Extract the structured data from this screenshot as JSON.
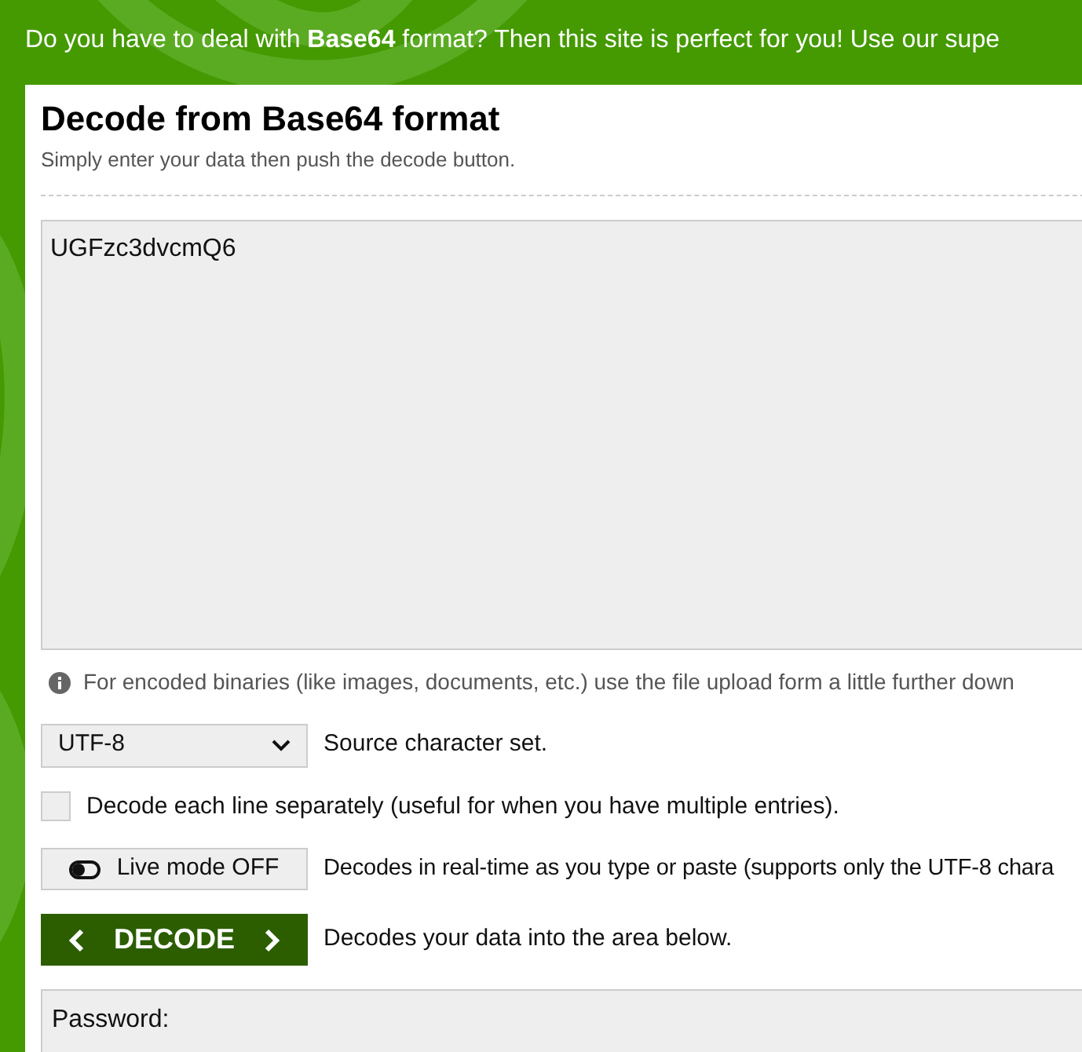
{
  "banner": {
    "text": "Do you have to deal with **Base64** format? Then this site is perfect for you! Use our supe"
  },
  "panel": {
    "title": "Decode from Base64 format",
    "subtitle": "Simply enter your data then push the decode button."
  },
  "input": {
    "value": "UGFzc3dvcmQ6"
  },
  "info": "For encoded binaries (like images, documents, etc.) use the file upload form a little further down",
  "charset": {
    "value": "UTF-8",
    "description": "Source character set."
  },
  "separate_lines": {
    "checked": false,
    "label": "Decode each line separately (useful for when you have multiple entries)."
  },
  "live_mode": {
    "on": false,
    "button": "Live mode OFF",
    "description": "Decodes in real-time as you type or paste (supports only the UTF-8 chara"
  },
  "decode": {
    "button": "DECODE",
    "description": "Decodes your data into the area below."
  },
  "password": {
    "label": "Password:"
  }
}
